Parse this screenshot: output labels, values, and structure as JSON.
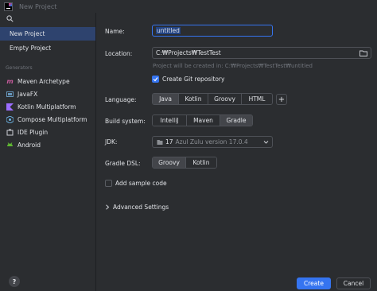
{
  "window": {
    "title": "New Project"
  },
  "sidebar": {
    "items": [
      {
        "label": "New Project"
      },
      {
        "label": "Empty Project"
      }
    ],
    "generators_header": "Generators",
    "generators": [
      {
        "label": "Maven Archetype",
        "icon": "maven-icon"
      },
      {
        "label": "JavaFX",
        "icon": "javafx-icon"
      },
      {
        "label": "Kotlin Multiplatform",
        "icon": "kotlin-icon"
      },
      {
        "label": "Compose Multiplatform",
        "icon": "compose-icon"
      },
      {
        "label": "IDE Plugin",
        "icon": "plugin-icon"
      },
      {
        "label": "Android",
        "icon": "android-icon"
      }
    ],
    "help": "?"
  },
  "form": {
    "name_label": "Name:",
    "name_value": "untitled",
    "location_label": "Location:",
    "location_value": "C:₩Projects₩TestTest",
    "location_hint": "Project will be created in: C:₩Projects₩TestTest₩untitled",
    "git_label": "Create Git repository",
    "git_checked": true,
    "language_label": "Language:",
    "languages": [
      "Java",
      "Kotlin",
      "Groovy",
      "HTML"
    ],
    "language_selected": "Java",
    "plus": "+",
    "build_label": "Build system:",
    "build_systems": [
      "IntelliJ",
      "Maven",
      "Gradle"
    ],
    "build_selected": "Gradle",
    "jdk_label": "JDK:",
    "jdk_number": "17",
    "jdk_desc": "Azul Zulu version 17.0.4",
    "dsl_label": "Gradle DSL:",
    "dsl_options": [
      "Groovy",
      "Kotlin"
    ],
    "dsl_selected": "Groovy",
    "sample_label": "Add sample code",
    "sample_checked": false,
    "advanced_label": "Advanced Settings"
  },
  "footer": {
    "create": "Create",
    "cancel": "Cancel"
  },
  "colors": {
    "accent": "#3574f0",
    "selection": "#2e436e",
    "background": "#2b2d30"
  }
}
